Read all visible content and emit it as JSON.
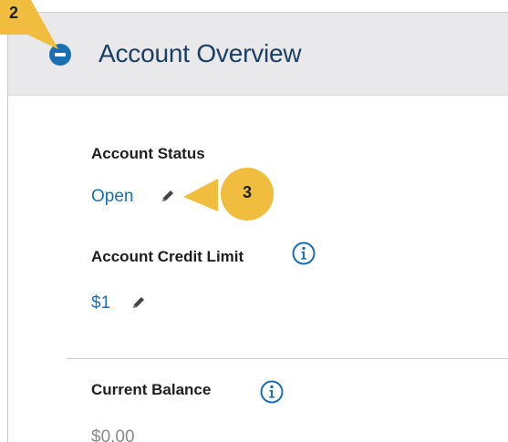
{
  "section": {
    "title": "Account Overview",
    "collapse_icon": "minus-circle-icon"
  },
  "fields": {
    "account_status": {
      "label": "Account Status",
      "value": "Open",
      "edit_icon": "pencil-icon"
    },
    "credit_limit": {
      "label": "Account Credit Limit",
      "value": "$1",
      "info_icon": "info-icon",
      "edit_icon": "pencil-icon"
    },
    "current_balance": {
      "label": "Current Balance",
      "value": "$0.00",
      "info_icon": "info-icon"
    }
  },
  "callouts": {
    "step_2": "2",
    "step_3": "3",
    "color": "#f1bd3e"
  },
  "colors": {
    "accent": "#1a6fb3",
    "header_bg": "#e9e9ec",
    "title_text": "#1b3f63"
  }
}
